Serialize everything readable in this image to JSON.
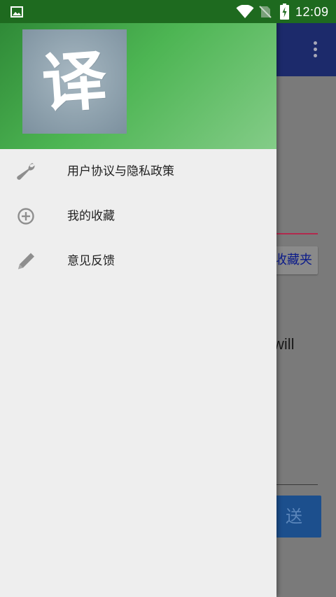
{
  "status_bar": {
    "time": "12:09",
    "icons": [
      "gallery-icon",
      "wifi-icon",
      "no-sim-icon",
      "battery-charging-icon"
    ]
  },
  "drawer": {
    "avatar_glyph": "译",
    "menu": [
      {
        "icon": "wrench-icon",
        "label": "用户协议与隐私政策"
      },
      {
        "icon": "add-circle-icon",
        "label": "我的收藏"
      },
      {
        "icon": "pencil-icon",
        "label": "意见反馈"
      }
    ]
  },
  "background_app": {
    "favorites_button_partial": "收藏夹",
    "text_partial": "will",
    "send_button_partial": "送"
  },
  "colors": {
    "status_bar": "#1e6a1f",
    "header_green": "#4db553",
    "toolbar_dimmed": "#1c2a6b",
    "drawer_bg": "#eeeeee"
  }
}
